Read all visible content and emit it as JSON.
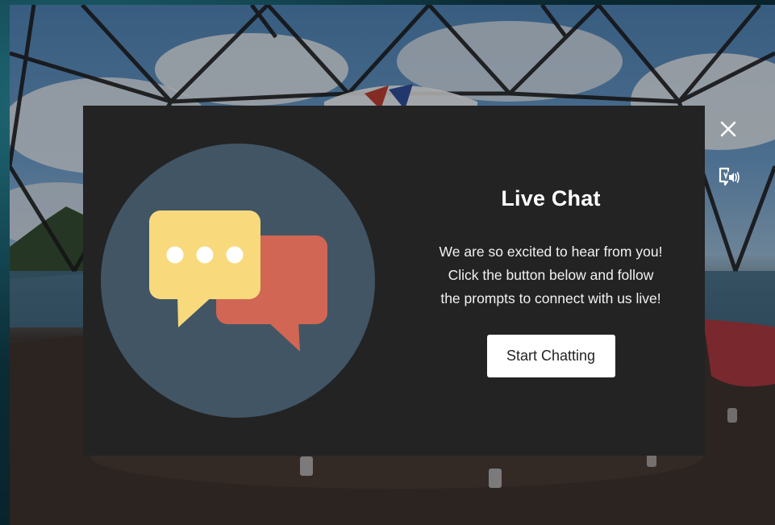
{
  "modal": {
    "title": "Live Chat",
    "description_lines": [
      "We are so excited to hear from you!",
      "Click the button below and follow",
      "the prompts to connect with us live!"
    ],
    "start_label": "Start Chatting"
  },
  "controls": {
    "close_icon": "close-icon",
    "audio_icon": "audio-description-icon"
  },
  "colors": {
    "modal_bg": "#232323",
    "circle_bg": "#415565",
    "bubble_yellow": "#f8d97c",
    "bubble_red": "#d06653",
    "button_bg": "#ffffff"
  }
}
